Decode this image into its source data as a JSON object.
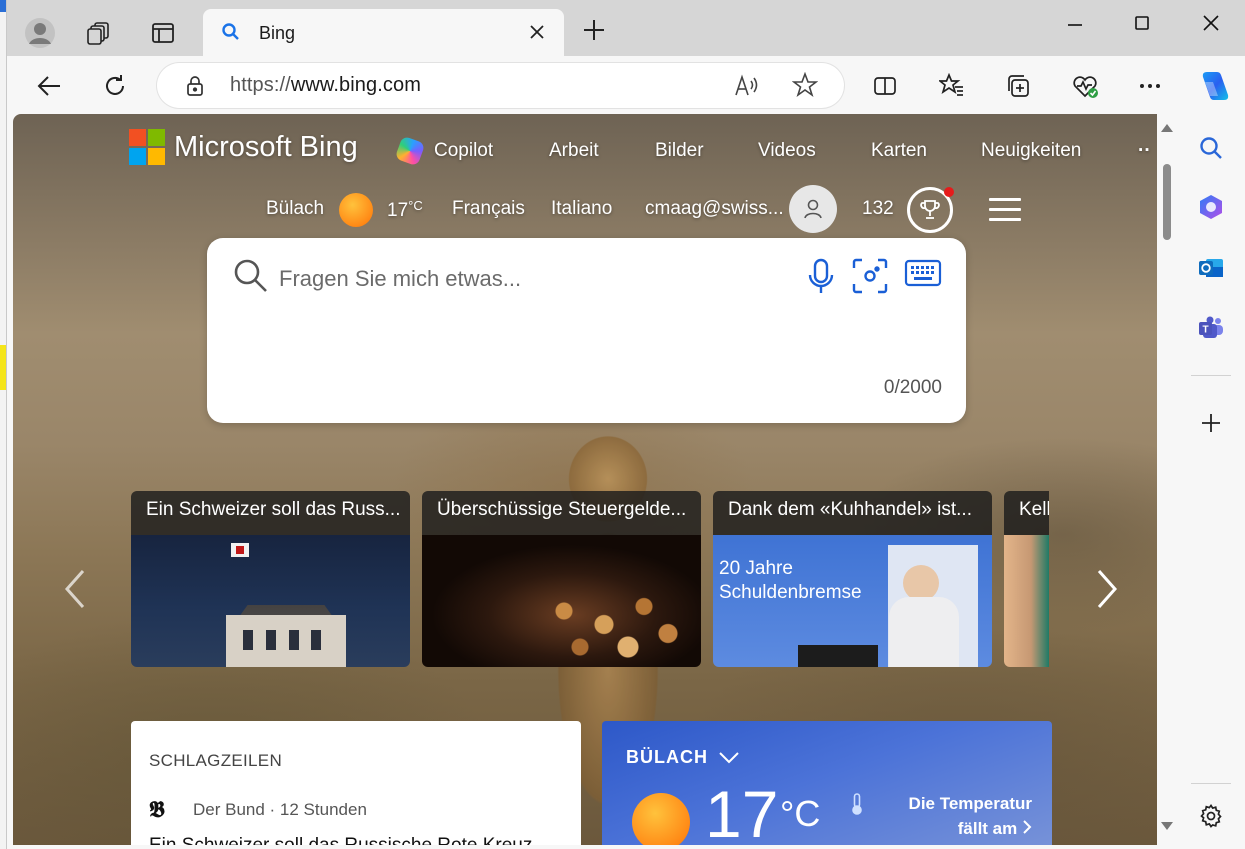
{
  "browser": {
    "tab": {
      "title": "Bing"
    },
    "address": {
      "scheme": "https://",
      "host": "www.bing.com"
    }
  },
  "bing": {
    "logo_text": "Microsoft Bing",
    "nav": [
      "Copilot",
      "Arbeit",
      "Bilder",
      "Videos",
      "Karten",
      "Neuigkeiten"
    ],
    "more": "··",
    "location": "Bülach",
    "temperature": "17",
    "temp_unit": "°C",
    "lang_1": "Français",
    "lang_2": "Italiano",
    "account": "cmaag@swiss...",
    "points": "132",
    "search": {
      "placeholder": "Fragen Sie mich etwas...",
      "counter": "0/2000"
    },
    "carousel": [
      {
        "caption": "Ein Schweizer soll das Russ..."
      },
      {
        "caption": "Überschüssige Steuergelde..."
      },
      {
        "caption": "Dank dem «Kuhhandel» ist..."
      },
      {
        "caption": "Kell"
      }
    ],
    "card3_image_text_1": "20 Jahre",
    "card3_image_text_2": "Schuldenbremse",
    "news": {
      "title": "SCHLAGZEILEN",
      "source": "Der Bund · 12 Stunden",
      "headline": "Ein Schweizer soll das Russische Rote Kreuz"
    },
    "weather": {
      "location": "BÜLACH",
      "temp": "17",
      "unit": "°C",
      "alert_line1": "Die Temperatur",
      "alert_line2": "fällt am"
    }
  },
  "colors": {
    "ms_red": "#f25022",
    "ms_green": "#7fba00",
    "ms_blue": "#00a4ef",
    "ms_yellow": "#ffb900",
    "accent_blue": "#1a5fd6"
  }
}
